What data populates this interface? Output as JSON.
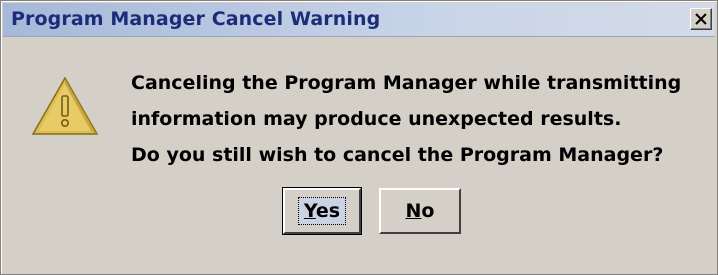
{
  "window": {
    "title": "Program Manager Cancel Warning",
    "close_glyph": "X"
  },
  "icon": {
    "name": "warning-icon",
    "glyph": "!",
    "color": "#d8b84c"
  },
  "message": {
    "lines": [
      "Canceling the Program Manager while transmitting",
      "information may produce unexpected results.",
      "Do you still wish to cancel the Program Manager?"
    ]
  },
  "buttons": {
    "yes": {
      "mnemonic": "Y",
      "rest": "es"
    },
    "no": {
      "mnemonic": "N",
      "rest": "o"
    }
  }
}
